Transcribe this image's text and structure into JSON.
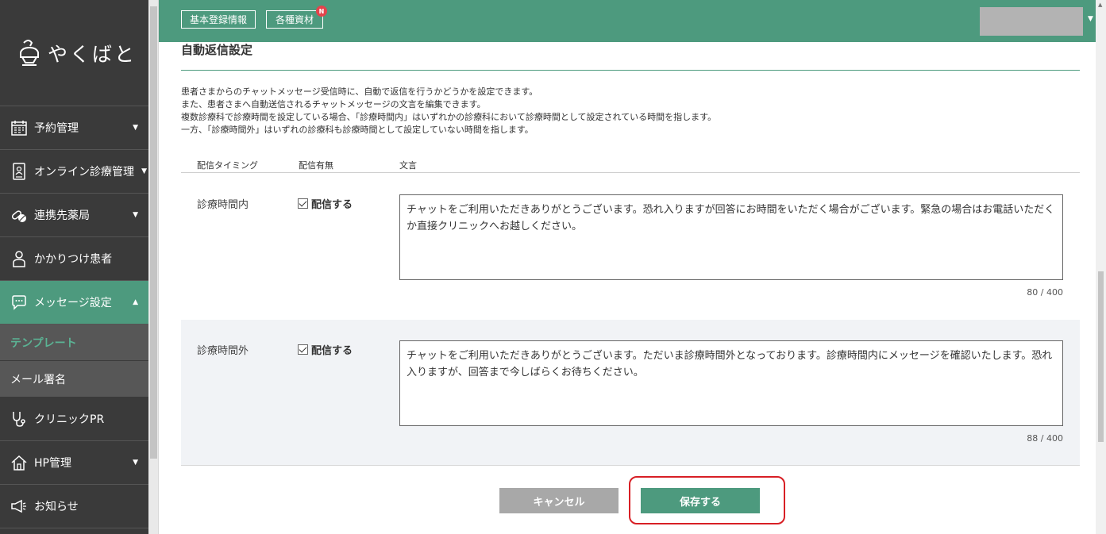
{
  "sidebar": {
    "logo_text": "やくばと",
    "items": [
      {
        "label": "予約管理",
        "icon": "calendar-icon",
        "caret": "▼"
      },
      {
        "label": "オンライン診療管理",
        "icon": "tablet-icon",
        "caret": "▼"
      },
      {
        "label": "連携先薬局",
        "icon": "pills-icon",
        "caret": "▼"
      },
      {
        "label": "かかりつけ患者",
        "icon": "person-icon"
      },
      {
        "label": "メッセージ設定",
        "icon": "chat-icon",
        "caret": "▲"
      },
      {
        "label": "クリニックPR",
        "icon": "stethoscope-icon"
      },
      {
        "label": "HP管理",
        "icon": "home-icon",
        "caret": "▼"
      },
      {
        "label": "お知らせ",
        "icon": "megaphone-icon"
      }
    ],
    "sub_items": [
      {
        "label": "テンプレート"
      },
      {
        "label": "メール署名"
      }
    ]
  },
  "header": {
    "btn_basic_info": "基本登録情報",
    "btn_materials": "各種資材",
    "badge": "N",
    "user_caret": "▼"
  },
  "main": {
    "title": "自動返信設定",
    "description": [
      "患者さまからのチャットメッセージ受信時に、自動で返信を行うかどうかを設定できます。",
      "また、患者さまへ自動送信されるチャットメッセージの文言を編集できます。",
      "複数診療科で診療時間を設定している場合、「診療時間内」はいずれかの診療科において診療時間として設定されている時間を指します。",
      "一方、「診療時間外」はいずれの診療科も診療時間として設定していない時間を指します。"
    ],
    "columns": {
      "timing": "配信タイミング",
      "enabled": "配信有無",
      "text": "文言"
    },
    "rows": [
      {
        "timing": "診療時間内",
        "checkbox_label": "配信する",
        "checked": true,
        "message": "チャットをご利用いただきありがとうございます。恐れ入りますが回答にお時間をいただく場合がございます。緊急の場合はお電話いただくか直接クリニックへお越しください。",
        "counter": "80 / 400"
      },
      {
        "timing": "診療時間外",
        "checkbox_label": "配信する",
        "checked": true,
        "message": "チャットをご利用いただきありがとうございます。ただいま診療時間外となっております。診療時間内にメッセージを確認いたします。恐れ入りますが、回答まで今しばらくお待ちください。",
        "counter": "88 / 400"
      }
    ],
    "cancel_label": "キャンセル",
    "save_label": "保存する"
  },
  "colors": {
    "accent": "#4d9a7e",
    "sidebar_bg": "#3a3a3a",
    "highlight": "#d81f25"
  }
}
